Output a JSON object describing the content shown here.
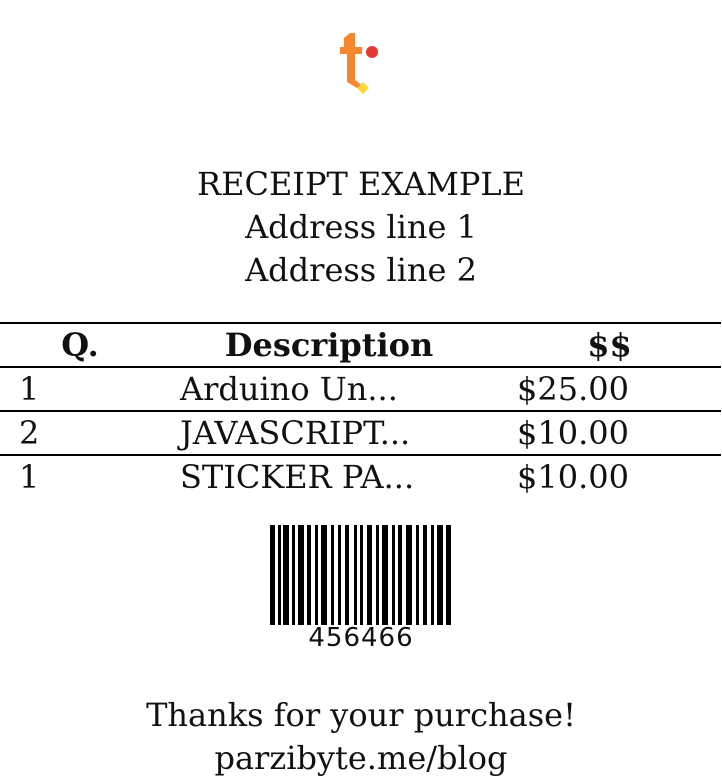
{
  "logo": {
    "icon": "brand-logo-icon",
    "colors": {
      "primary": "#f7872e",
      "dot": "#e53935",
      "diamond": "#ffd43b"
    }
  },
  "header": {
    "title": "RECEIPT EXAMPLE",
    "address_line_1": "Address line 1",
    "address_line_2": "Address line 2"
  },
  "table": {
    "columns": [
      "Q.",
      "Description",
      "$$"
    ],
    "rows": [
      {
        "quantity": "1",
        "description": "Arduino Un...",
        "price": "$25.00"
      },
      {
        "quantity": "2",
        "description": "JAVASCRIPT...",
        "price": "$10.00"
      },
      {
        "quantity": "1",
        "description": "STICKER PA...",
        "price": "$10.00"
      }
    ]
  },
  "barcode": {
    "icon": "barcode-icon",
    "value": "456466"
  },
  "footer": {
    "thanks": "Thanks for your purchase!",
    "link": "parzibyte.me/blog"
  }
}
